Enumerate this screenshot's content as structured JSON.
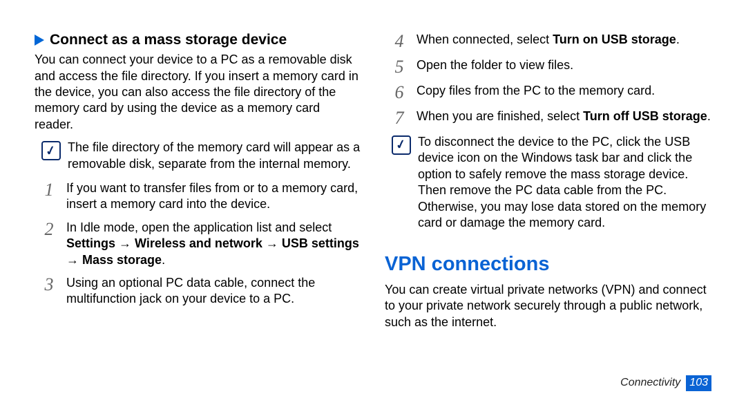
{
  "left": {
    "heading": "Connect as a mass storage device",
    "intro": "You can connect your device to a PC as a removable disk and access the file directory. If you insert a memory card in the device, you can also access the file directory of the memory card by using the device as a memory card reader.",
    "note": "The file directory of the memory card will appear as a removable disk, separate from the internal memory.",
    "step1": "If you want to transfer files from or to a memory card, insert a memory card into the device.",
    "step2_a": "In Idle mode, open the application list and select ",
    "step2_b": "Settings → Wireless and network → USB settings → Mass storage",
    "step2_c": ".",
    "step3": "Using an optional PC data cable, connect the multifunction jack on your device to a PC."
  },
  "right": {
    "step4_a": "When connected, select ",
    "step4_b": "Turn on USB storage",
    "step4_c": ".",
    "step5": "Open the folder to view files.",
    "step6": "Copy files from the PC to the memory card.",
    "step7_a": "When you are finished, select ",
    "step7_b": "Turn off USB storage",
    "step7_c": ".",
    "note": "To disconnect the device to the PC, click the USB device icon on the Windows task bar and click the option to safely remove the mass storage device. Then remove the PC data cable from the PC. Otherwise, you may lose data stored on the memory card or damage the memory card.",
    "h1": "VPN connections",
    "vpn_para": "You can create virtual private networks (VPN) and connect to your private network securely through a public network, such as the internet."
  },
  "footer": {
    "section": "Connectivity",
    "page": "103"
  },
  "nums": {
    "n1": "1",
    "n2": "2",
    "n3": "3",
    "n4": "4",
    "n5": "5",
    "n6": "6",
    "n7": "7"
  }
}
